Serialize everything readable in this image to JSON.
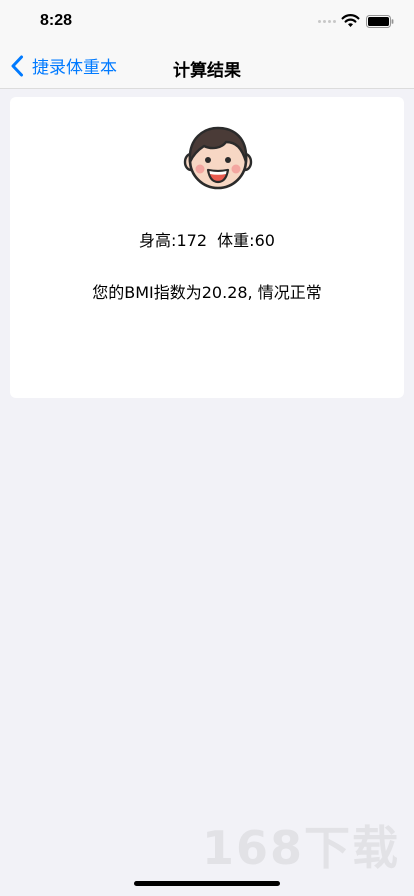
{
  "status_bar": {
    "time": "8:28",
    "wifi_icon": "wifi-icon",
    "battery_icon": "battery-icon"
  },
  "nav": {
    "back_label": "捷录体重本",
    "back_icon": "chevron-back-icon",
    "title": "计算结果"
  },
  "result": {
    "face_icon": "smiling-face-icon",
    "height_label": "身高:",
    "height_value": "172",
    "weight_label": "体重:",
    "weight_value": "60",
    "bmi_text": "您的BMI指数为20.28, 情况正常"
  },
  "watermark": {
    "text": "168下载"
  },
  "colors": {
    "accent": "#007aff",
    "background": "#f2f2f7",
    "card": "#ffffff",
    "face_hair": "#4a3b37",
    "face_skin": "#f7d7c4"
  }
}
